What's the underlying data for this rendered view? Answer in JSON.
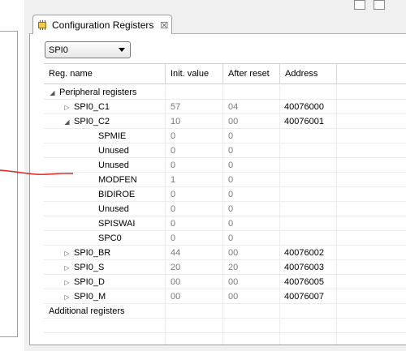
{
  "tab": {
    "title": "Configuration Registers",
    "close_glyph": "☒",
    "icon": "chip-icon"
  },
  "module_select": {
    "selected": "SPI0"
  },
  "columns": [
    "Reg. name",
    "Init. value",
    "After reset",
    "Address"
  ],
  "rows": [
    {
      "indent": 0,
      "twisty": "expanded",
      "name": "Peripheral registers",
      "init": "",
      "reset": "",
      "address": ""
    },
    {
      "indent": 1,
      "twisty": "collapsed",
      "name": "SPI0_C1",
      "init": "57",
      "reset": "04",
      "address": "40076000"
    },
    {
      "indent": 1,
      "twisty": "expanded",
      "name": "SPI0_C2",
      "init": "10",
      "reset": "00",
      "address": "40076001"
    },
    {
      "indent": 2,
      "twisty": "none",
      "name": "SPMIE",
      "init": "0",
      "reset": "0",
      "address": ""
    },
    {
      "indent": 2,
      "twisty": "none",
      "name": "Unused",
      "init": "0",
      "reset": "0",
      "address": ""
    },
    {
      "indent": 2,
      "twisty": "none",
      "name": "Unused",
      "init": "0",
      "reset": "0",
      "address": ""
    },
    {
      "indent": 2,
      "twisty": "none",
      "name": "MODFEN",
      "init": "1",
      "reset": "0",
      "address": ""
    },
    {
      "indent": 2,
      "twisty": "none",
      "name": "BIDIROE",
      "init": "0",
      "reset": "0",
      "address": ""
    },
    {
      "indent": 2,
      "twisty": "none",
      "name": "Unused",
      "init": "0",
      "reset": "0",
      "address": ""
    },
    {
      "indent": 2,
      "twisty": "none",
      "name": "SPISWAI",
      "init": "0",
      "reset": "0",
      "address": ""
    },
    {
      "indent": 2,
      "twisty": "none",
      "name": "SPC0",
      "init": "0",
      "reset": "0",
      "address": ""
    },
    {
      "indent": 1,
      "twisty": "collapsed",
      "name": "SPI0_BR",
      "init": "44",
      "reset": "00",
      "address": "40076002"
    },
    {
      "indent": 1,
      "twisty": "collapsed",
      "name": "SPI0_S",
      "init": "20",
      "reset": "20",
      "address": "40076003"
    },
    {
      "indent": 1,
      "twisty": "collapsed",
      "name": "SPI0_D",
      "init": "00",
      "reset": "00",
      "address": "40076005"
    },
    {
      "indent": 1,
      "twisty": "collapsed",
      "name": "SPI0_M",
      "init": "00",
      "reset": "00",
      "address": "40076007"
    },
    {
      "indent": 0,
      "twisty": "none",
      "name": "Additional registers",
      "init": "",
      "reset": "",
      "address": ""
    },
    {
      "indent": 0,
      "twisty": "none",
      "name": "",
      "init": "",
      "reset": "",
      "address": ""
    },
    {
      "indent": 0,
      "twisty": "none",
      "name": "",
      "init": "",
      "reset": "",
      "address": ""
    }
  ],
  "colors": {
    "annotation": "#e02020",
    "value_gray": "#7a7a7a"
  }
}
